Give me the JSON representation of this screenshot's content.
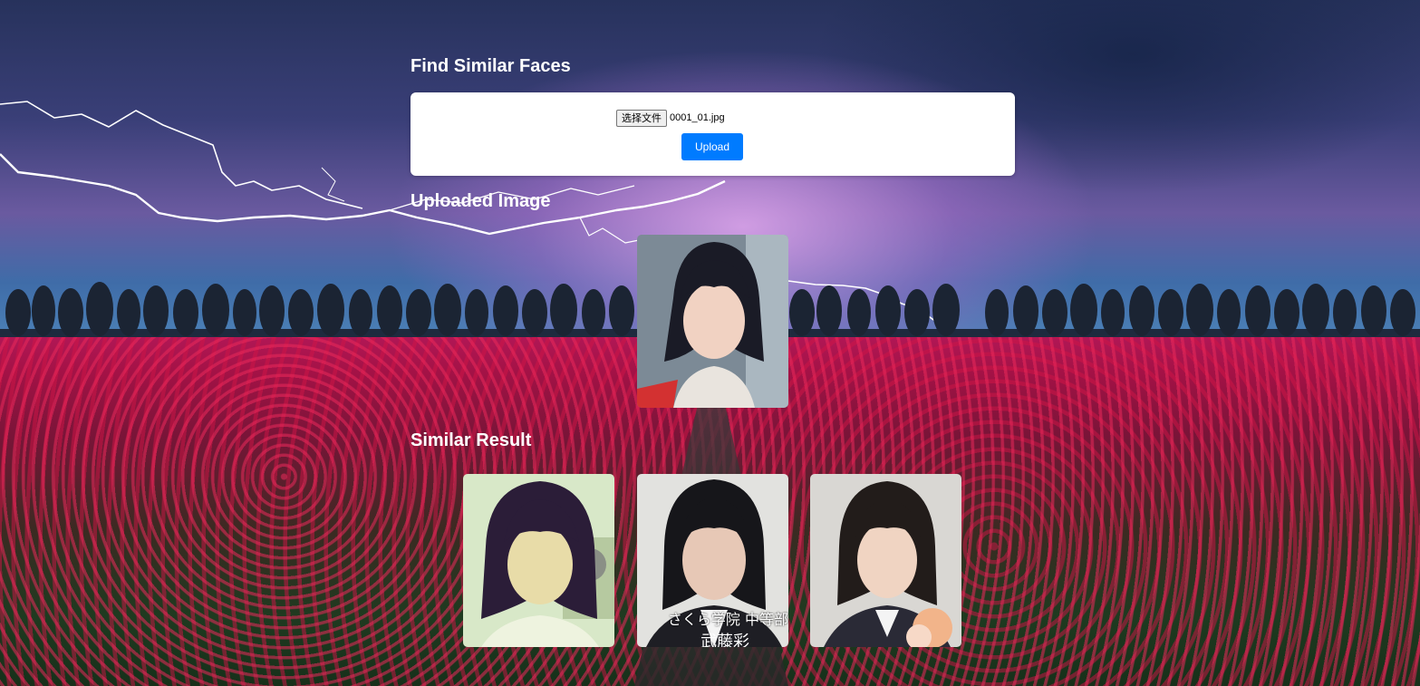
{
  "page": {
    "title": "Find Similar Faces"
  },
  "upload_form": {
    "choose_file_label": "选择文件",
    "file_name": "0001_01.jpg",
    "upload_label": "Upload"
  },
  "uploaded_section": {
    "heading": "Uploaded Image"
  },
  "results_section": {
    "heading": "Similar Result",
    "results": [
      {
        "caption": ""
      },
      {
        "caption": "さくら学院 中等部",
        "caption_secondary": "武藤彩"
      },
      {
        "caption": ""
      }
    ]
  },
  "colors": {
    "accent": "#007bff",
    "card_bg": "#ffffff",
    "heading_text": "#ffffff"
  }
}
